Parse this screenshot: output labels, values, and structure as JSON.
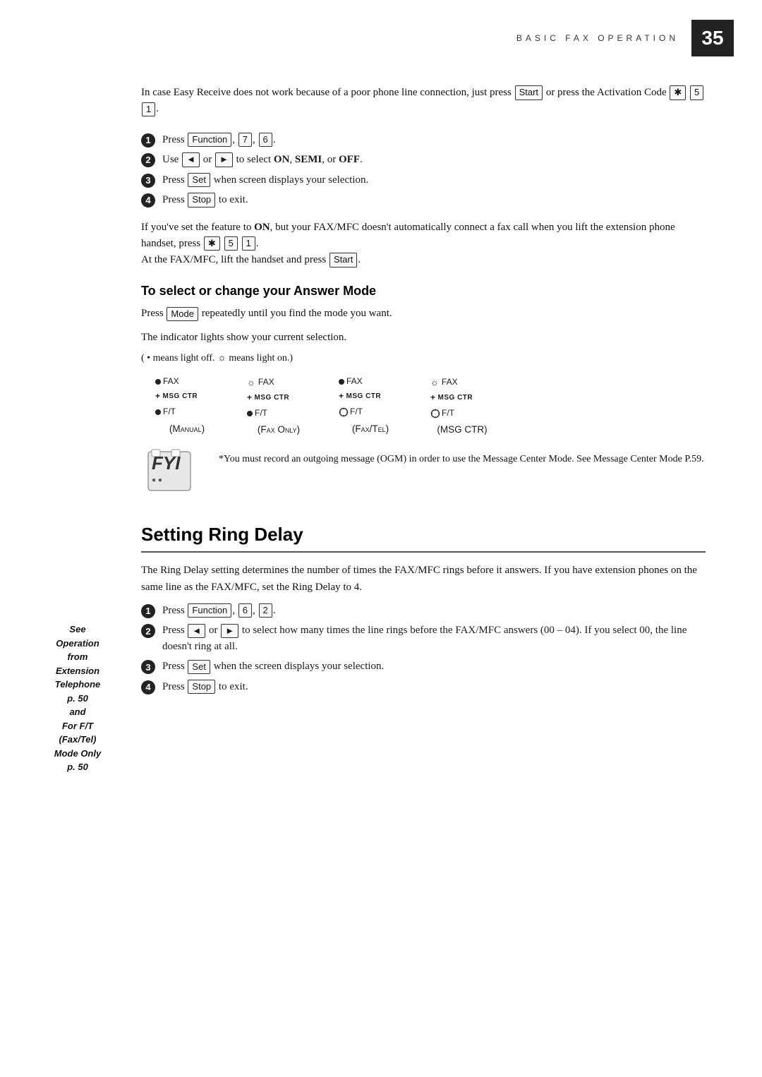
{
  "header": {
    "title": "BASIC FAX OPERATION",
    "page_number": "35"
  },
  "intro": {
    "text": "In case Easy Receive does not work because of a poor phone line connection, just press",
    "text2": "or press the Activation Code",
    "keys_start": [
      "Start"
    ],
    "keys_activation": [
      "*",
      "5",
      "1"
    ]
  },
  "steps_top": [
    {
      "number": "1",
      "text": "Press",
      "keys": [
        "Function",
        "7",
        "6"
      ]
    },
    {
      "number": "2",
      "text": "Use",
      "left_arrow": "◄",
      "right_arrow": "►",
      "text2": "to select",
      "options": "ON, SEMI, or OFF."
    },
    {
      "number": "3",
      "text": "Press",
      "key": "Set",
      "text2": "when screen displays your selection."
    },
    {
      "number": "4",
      "text": "Press",
      "key": "Stop",
      "text2": "to exit."
    }
  ],
  "middle_text": {
    "line1": "If you've set the feature to ON, but your FAX/MFC doesn't automatically connect",
    "line2": "a fax call when you lift the extension phone handset, press",
    "keys": [
      "*",
      "5",
      "1"
    ],
    "line3": "At the FAX/MFC, lift the handset and press",
    "key_start": "Start"
  },
  "answer_mode": {
    "heading": "To select or change your Answer Mode",
    "text1": "Press",
    "key_mode": "Mode",
    "text1b": "repeatedly until you find the mode you want.",
    "text2": "The indicator lights show your current selection.",
    "text3": "( • means light  off. ☼ means light  on.)",
    "modes": [
      {
        "label": "Manual",
        "fax": "●",
        "fax_type": "filled",
        "fax_label": "FAX",
        "msg_ctr": "MSG CTR",
        "msg_arrow": "+",
        "ft": "●",
        "ft_type": "filled",
        "ft_label": "F/T"
      },
      {
        "label": "Fax Only",
        "fax": "☼",
        "fax_type": "sun",
        "fax_label": "FAX",
        "msg_ctr": "MSG CTR",
        "msg_arrow": "+",
        "ft": "●",
        "ft_type": "filled",
        "ft_label": "F/T"
      },
      {
        "label": "Fax/Tel",
        "fax": "●",
        "fax_type": "filled",
        "fax_label": "FAX",
        "msg_ctr": "MSG CTR",
        "msg_arrow": "+",
        "ft": "☼",
        "ft_type": "sun-ring",
        "ft_label": "F/T"
      },
      {
        "label": "MSG CTR",
        "fax": "☼",
        "fax_type": "sun",
        "fax_label": "FAX",
        "msg_ctr": "MSG CTR",
        "msg_arrow": "+",
        "ft": "☼",
        "ft_type": "sun-ring",
        "ft_label": "F/T"
      }
    ],
    "note_text": "*You must record an outgoing message (OGM) in order to use the Message Center Mode. See Message Center Mode P.59."
  },
  "ring_delay": {
    "heading": "Setting Ring Delay",
    "text1": "The Ring Delay setting determines the number of times the FAX/MFC rings before it answers. If you have extension phones on the same line as the FAX/MFC, set the Ring Delay to 4.",
    "steps": [
      {
        "number": "1",
        "text": "Press",
        "keys": [
          "Function",
          "6",
          "2"
        ]
      },
      {
        "number": "2",
        "text": "Press",
        "left_arrow": "◄",
        "right_arrow": "►",
        "text2": "to select how many times the line rings before the FAX/MFC answers (00 – 04). If you select 00, the line doesn't ring at all."
      },
      {
        "number": "3",
        "text": "Press",
        "key": "Set",
        "text2": "when the screen displays your selection."
      },
      {
        "number": "4",
        "text": "Press",
        "key": "Stop",
        "text2": "to exit."
      }
    ],
    "sidebar": {
      "line1": "See",
      "line2": "Operation",
      "line3": "from",
      "line4": "Extension",
      "line5": "Telephone",
      "line6": "p. 50",
      "line7": "and",
      "line8": "For F/T",
      "line9": "(Fax/Tel)",
      "line10": "Mode Only",
      "line11": "p. 50"
    }
  }
}
